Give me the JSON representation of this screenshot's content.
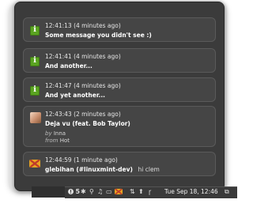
{
  "notifications": [
    {
      "icon": "info-icon",
      "time": "12:41:13 (4 minutes ago)",
      "message": "Some message you didn't see :)"
    },
    {
      "icon": "info-icon",
      "time": "12:41:41 (4 minutes ago)",
      "message": "And another..."
    },
    {
      "icon": "info-icon",
      "time": "12:41:47 (4 minutes ago)",
      "message": "And yet another..."
    },
    {
      "icon": "album-art-icon",
      "time": "12:43:43 (2 minutes ago)",
      "message": "Deja vu (feat. Bob Taylor)",
      "by_label": "by",
      "by_value": "Inna",
      "from_label": "from",
      "from_value": "Hot"
    },
    {
      "icon": "xchat-icon",
      "time": "12:44:59 (1 minute ago)",
      "message": "glebihan (#linuxmint-dev)",
      "message_extra": "hi clem"
    }
  ],
  "taskbar": {
    "notification_count": "5",
    "clock": "Tue Sep 18, 12:46"
  },
  "colors": {
    "popup_bg": "#3b3b3b",
    "notification_bg": "#454545",
    "info_icon": "#5aa321"
  }
}
